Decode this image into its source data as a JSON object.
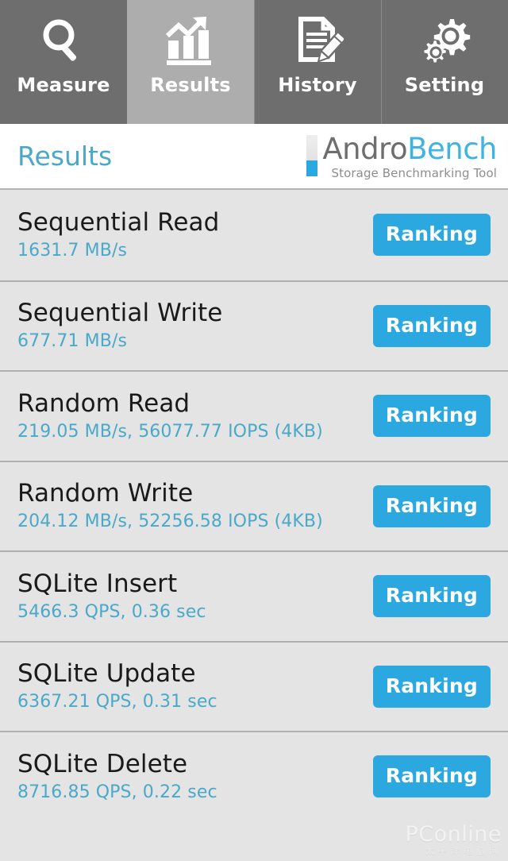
{
  "tabs": [
    {
      "id": "measure",
      "label": "Measure",
      "icon": "magnifier-icon",
      "selected": false
    },
    {
      "id": "results",
      "label": "Results",
      "icon": "bar-chart-arrow-icon",
      "selected": true
    },
    {
      "id": "history",
      "label": "History",
      "icon": "document-pencil-icon",
      "selected": false
    },
    {
      "id": "setting",
      "label": "Setting",
      "icon": "gears-icon",
      "selected": false
    }
  ],
  "header": {
    "title": "Results",
    "logo_primary": "Andro",
    "logo_secondary": "Bench",
    "logo_subtitle": "Storage Benchmarking Tool"
  },
  "results": [
    {
      "title": "Sequential Read",
      "value": "1631.7 MB/s",
      "button": "Ranking"
    },
    {
      "title": "Sequential Write",
      "value": "677.71 MB/s",
      "button": "Ranking"
    },
    {
      "title": "Random Read",
      "value": "219.05 MB/s, 56077.77 IOPS (4KB)",
      "button": "Ranking"
    },
    {
      "title": "Random Write",
      "value": "204.12 MB/s, 52256.58 IOPS (4KB)",
      "button": "Ranking"
    },
    {
      "title": "SQLite Insert",
      "value": "5466.3 QPS, 0.36 sec",
      "button": "Ranking"
    },
    {
      "title": "SQLite Update",
      "value": "6367.21 QPS, 0.31 sec",
      "button": "Ranking"
    },
    {
      "title": "SQLite Delete",
      "value": "8716.85 QPS, 0.22 sec",
      "button": "Ranking"
    }
  ],
  "watermark": {
    "main": "PConline",
    "sub": "太平洋电脑网"
  },
  "colors": {
    "accent_blue": "#2ba8e0",
    "value_blue": "#4aa8c9",
    "tab_bar": "#6e6e6e",
    "tab_selected": "#adadad",
    "list_bg": "#e4e4e4",
    "separator": "#b0b0b0"
  }
}
